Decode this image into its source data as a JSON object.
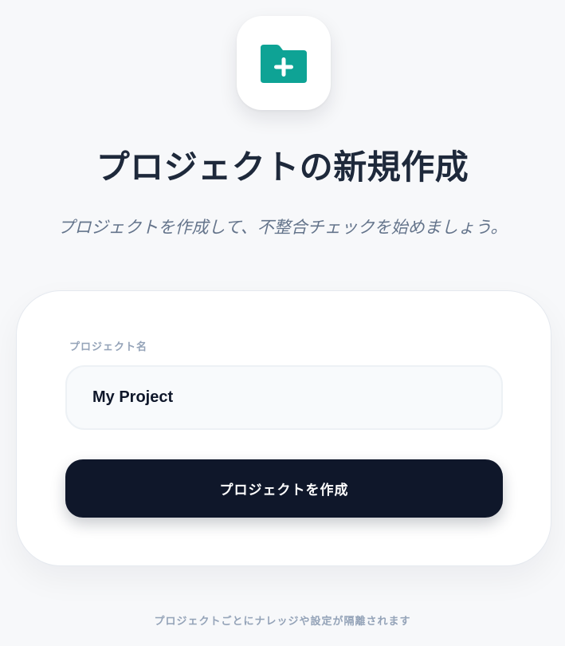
{
  "header": {
    "icon": "folder-plus-icon",
    "icon_color": "#0ea395",
    "title": "プロジェクトの新規作成",
    "subtitle": "プロジェクトを作成して、不整合チェックを始めましょう。"
  },
  "form": {
    "project_name_label": "プロジェクト名",
    "project_name_value": "My Project",
    "submit_label": "プロジェクトを作成"
  },
  "footer": {
    "note": "プロジェクトごとにナレッジや設定が隔離されます"
  },
  "colors": {
    "accent": "#0ea395",
    "button": "#0f172a",
    "background": "#f7f8fa"
  }
}
